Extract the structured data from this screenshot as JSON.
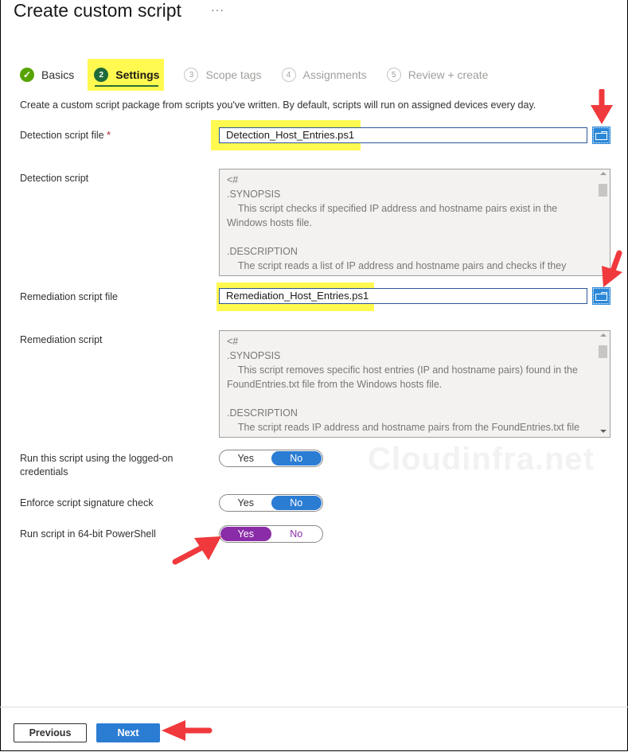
{
  "header": {
    "title": "Create custom script",
    "more_label": "···"
  },
  "wizard": {
    "steps": [
      {
        "number": "✓",
        "label": "Basics",
        "state": "done"
      },
      {
        "number": "2",
        "label": "Settings",
        "state": "active"
      },
      {
        "number": "3",
        "label": "Scope tags",
        "state": "pending"
      },
      {
        "number": "4",
        "label": "Assignments",
        "state": "pending"
      },
      {
        "number": "5",
        "label": "Review + create",
        "state": "pending"
      }
    ]
  },
  "form": {
    "description": "Create a custom script package from scripts you've written. By default, scripts will run on assigned devices every day.",
    "detection_file": {
      "label": "Detection script file",
      "required_mark": "*",
      "value": "Detection_Host_Entries.ps1"
    },
    "detection_script": {
      "label": "Detection script",
      "content": "<#\n.SYNOPSIS\n    This script checks if specified IP address and hostname pairs exist in the\nWindows hosts file.\n\n.DESCRIPTION\n    The script reads a list of IP address and hostname pairs and checks if they"
    },
    "remediation_file": {
      "label": "Remediation script file",
      "value": "Remediation_Host_Entries.ps1"
    },
    "remediation_script": {
      "label": "Remediation script",
      "content": "<#\n.SYNOPSIS\n    This script removes specific host entries (IP and hostname pairs) found in the\nFoundEntries.txt file from the Windows hosts file.\n\n.DESCRIPTION\n    The script reads IP address and hostname pairs from the FoundEntries.txt file"
    },
    "toggles": [
      {
        "label": "Run this script using the logged-on credentials",
        "yes": "Yes",
        "no": "No",
        "selected": "No"
      },
      {
        "label": "Enforce script signature check",
        "yes": "Yes",
        "no": "No",
        "selected": "No"
      },
      {
        "label": "Run script in 64-bit PowerShell",
        "yes": "Yes",
        "no": "No",
        "selected": "Yes"
      }
    ]
  },
  "watermark": "Cloudinfra.net",
  "footer": {
    "previous_label": "Previous",
    "next_label": "Next"
  },
  "colors": {
    "accent": "#2b7cd3",
    "highlight": "#fff950",
    "annotation_arrow": "#f0393c",
    "toggle_purple": "#8a2ca8",
    "step_done": "#57a300",
    "step_active": "#1e6b3a"
  }
}
